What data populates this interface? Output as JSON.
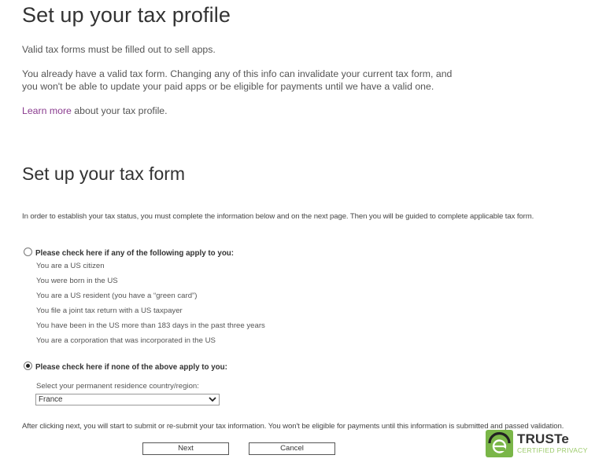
{
  "profile": {
    "title": "Set up your tax profile",
    "paragraph1": "Valid tax forms must be filled out to sell apps.",
    "paragraph2": "You already have a valid tax form. Changing any of this info can invalidate your current tax form, and you won't be able to update your paid apps or be eligible for payments until we have a valid one.",
    "learn_more_link": "Learn more",
    "learn_more_suffix": " about your tax profile."
  },
  "form": {
    "title": "Set up your tax form",
    "intro": "In order to establish your tax status, you must complete the information below and on the next page. Then you will be guided to complete applicable tax form.",
    "option_us": {
      "label": "Please check here if any of the following apply to you:",
      "checked": false,
      "conditions": [
        "You are a US citizen",
        "You were born in the US",
        "You are a US resident (you have a “green card”)",
        "You file a joint tax return with a US taxpayer",
        "You have been in the US more than 183 days in the past three years",
        "You are a corporation that was incorporated in the US"
      ]
    },
    "option_non_us": {
      "label": "Please check here if none of the above apply to you:",
      "checked": true,
      "select_label": "Select your permanent residence country/region:",
      "selected_country": "France"
    },
    "note": "After clicking next, you will start to submit or re-submit your tax information. You won't be eligible for payments until this information is submitted and passed validation.",
    "buttons": {
      "next": "Next",
      "cancel": "Cancel"
    }
  },
  "truste": {
    "name": "TRUSTe",
    "subtitle": "CERTIFIED PRIVACY",
    "brand_color": "#7ab648"
  },
  "colors": {
    "link": "#8a3b8f",
    "text": "#555555",
    "heading": "#333333"
  }
}
